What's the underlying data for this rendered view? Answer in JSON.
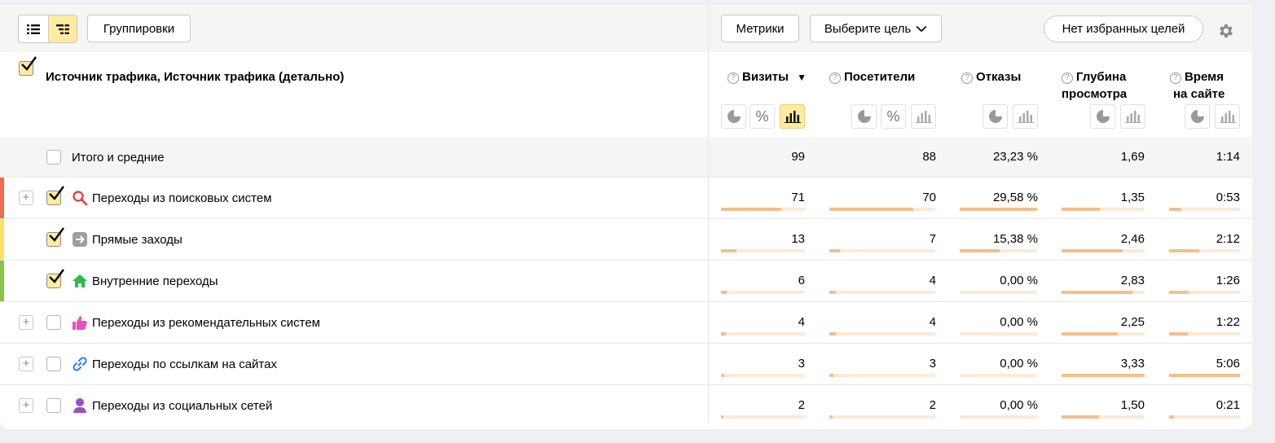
{
  "toolbar": {
    "groupings_label": "Группировки",
    "metrics_label": "Метрики",
    "goal_select_label": "Выберите цель",
    "favorites_label": "Нет избранных целей"
  },
  "header": {
    "title": "Источник трафика, Источник трафика (детально)",
    "columns": [
      {
        "label": "Визиты",
        "sort": "▼"
      },
      {
        "label": "Посетители"
      },
      {
        "label": "Отказы"
      },
      {
        "label_line1": "Глубина",
        "label_line2": "просмотра"
      },
      {
        "label_line1": "Время",
        "label_line2": "на сайте"
      }
    ],
    "help_glyph": "?"
  },
  "totals": {
    "label": "Итого и средние",
    "values": [
      "99",
      "88",
      "23,23 %",
      "1,69",
      "1:14"
    ]
  },
  "rows": [
    {
      "label": "Переходы из поисковых систем",
      "icon": "search-icon",
      "checked": true,
      "expandable": true,
      "accent": "#f36b4e",
      "values": [
        "71",
        "70",
        "29,58 %",
        "1,35",
        "0:53"
      ],
      "fills": [
        0.717,
        0.795,
        1.0,
        0.46,
        0.17
      ]
    },
    {
      "label": "Прямые заходы",
      "icon": "direct-arrow-icon",
      "checked": true,
      "expandable": false,
      "accent": "#ffe066",
      "values": [
        "13",
        "7",
        "15,38 %",
        "2,46",
        "2:12"
      ],
      "fills": [
        0.18,
        0.1,
        0.52,
        0.74,
        0.42
      ]
    },
    {
      "label": "Внутренние переходы",
      "icon": "home-icon",
      "checked": true,
      "expandable": false,
      "accent": "#8bc34a",
      "values": [
        "6",
        "4",
        "0,00 %",
        "2,83",
        "1:26"
      ],
      "fills": [
        0.07,
        0.06,
        0.0,
        0.85,
        0.28
      ]
    },
    {
      "label": "Переходы из рекомендательных систем",
      "icon": "thumbs-up-icon",
      "checked": false,
      "expandable": true,
      "accent": "",
      "values": [
        "4",
        "4",
        "0,00 %",
        "2,25",
        "1:22"
      ],
      "fills": [
        0.06,
        0.06,
        0.0,
        0.68,
        0.26
      ]
    },
    {
      "label": "Переходы по ссылкам на сайтах",
      "icon": "link-icon",
      "checked": false,
      "expandable": true,
      "accent": "",
      "values": [
        "3",
        "3",
        "0,00 %",
        "3,33",
        "5:06"
      ],
      "fills": [
        0.04,
        0.04,
        0.0,
        1.0,
        1.0
      ]
    },
    {
      "label": "Переходы из социальных сетей",
      "icon": "social-person-icon",
      "checked": false,
      "expandable": true,
      "accent": "",
      "values": [
        "2",
        "2",
        "0,00 %",
        "1,50",
        "0:21"
      ],
      "fills": [
        0.03,
        0.03,
        0.0,
        0.45,
        0.07
      ]
    }
  ],
  "colors": {
    "accent_yellow": "#ffeba0",
    "bar_track": "#fde9d6",
    "bar_fill": "#f6be8a"
  }
}
